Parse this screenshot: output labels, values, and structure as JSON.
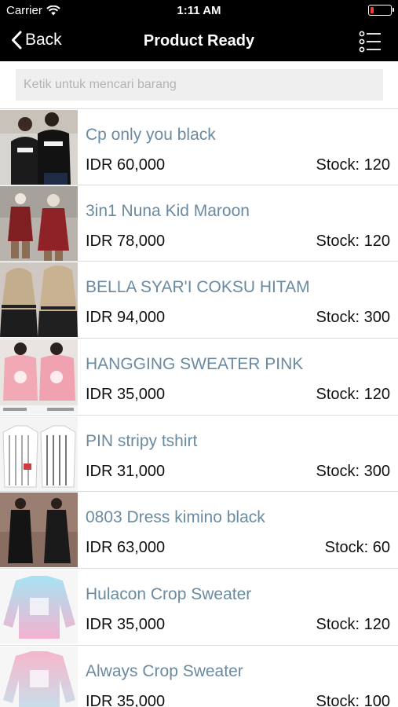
{
  "status_bar": {
    "carrier": "Carrier",
    "time": "1:11 AM",
    "wifi_icon": "wifi-icon",
    "battery_icon": "battery-low-icon",
    "battery_level": 0.15,
    "battery_color": "#ff3b30"
  },
  "nav": {
    "back_label": "Back",
    "title": "Product Ready",
    "back_icon": "chevron-left-icon",
    "menu_icon": "list-menu-icon"
  },
  "search": {
    "placeholder": "Ketik untuk mencari barang",
    "value": ""
  },
  "colors": {
    "nav_background": "#000000",
    "product_name": "#6a8aa0",
    "search_background": "#efefef"
  },
  "products": [
    {
      "name": "Cp only you black",
      "price": "IDR 60,000",
      "stock": "Stock: 120"
    },
    {
      "name": "3in1 Nuna Kid Maroon",
      "price": "IDR 78,000",
      "stock": "Stock: 120"
    },
    {
      "name": " BELLA SYAR'I COKSU HITAM",
      "price": "IDR 94,000",
      "stock": "Stock: 300"
    },
    {
      "name": "HANGGING SWEATER PINK",
      "price": "IDR 35,000",
      "stock": "Stock: 120"
    },
    {
      "name": "PIN stripy tshirt",
      "price": "IDR 31,000",
      "stock": "Stock: 300"
    },
    {
      "name": " 0803 Dress kimino black",
      "price": "IDR 63,000",
      "stock": "Stock: 60"
    },
    {
      "name": " Hulacon Crop Sweater",
      "price": "IDR 35,000",
      "stock": "Stock: 120"
    },
    {
      "name": "Always Crop Sweater",
      "price": "IDR 35,000",
      "stock": "Stock: 100"
    }
  ]
}
